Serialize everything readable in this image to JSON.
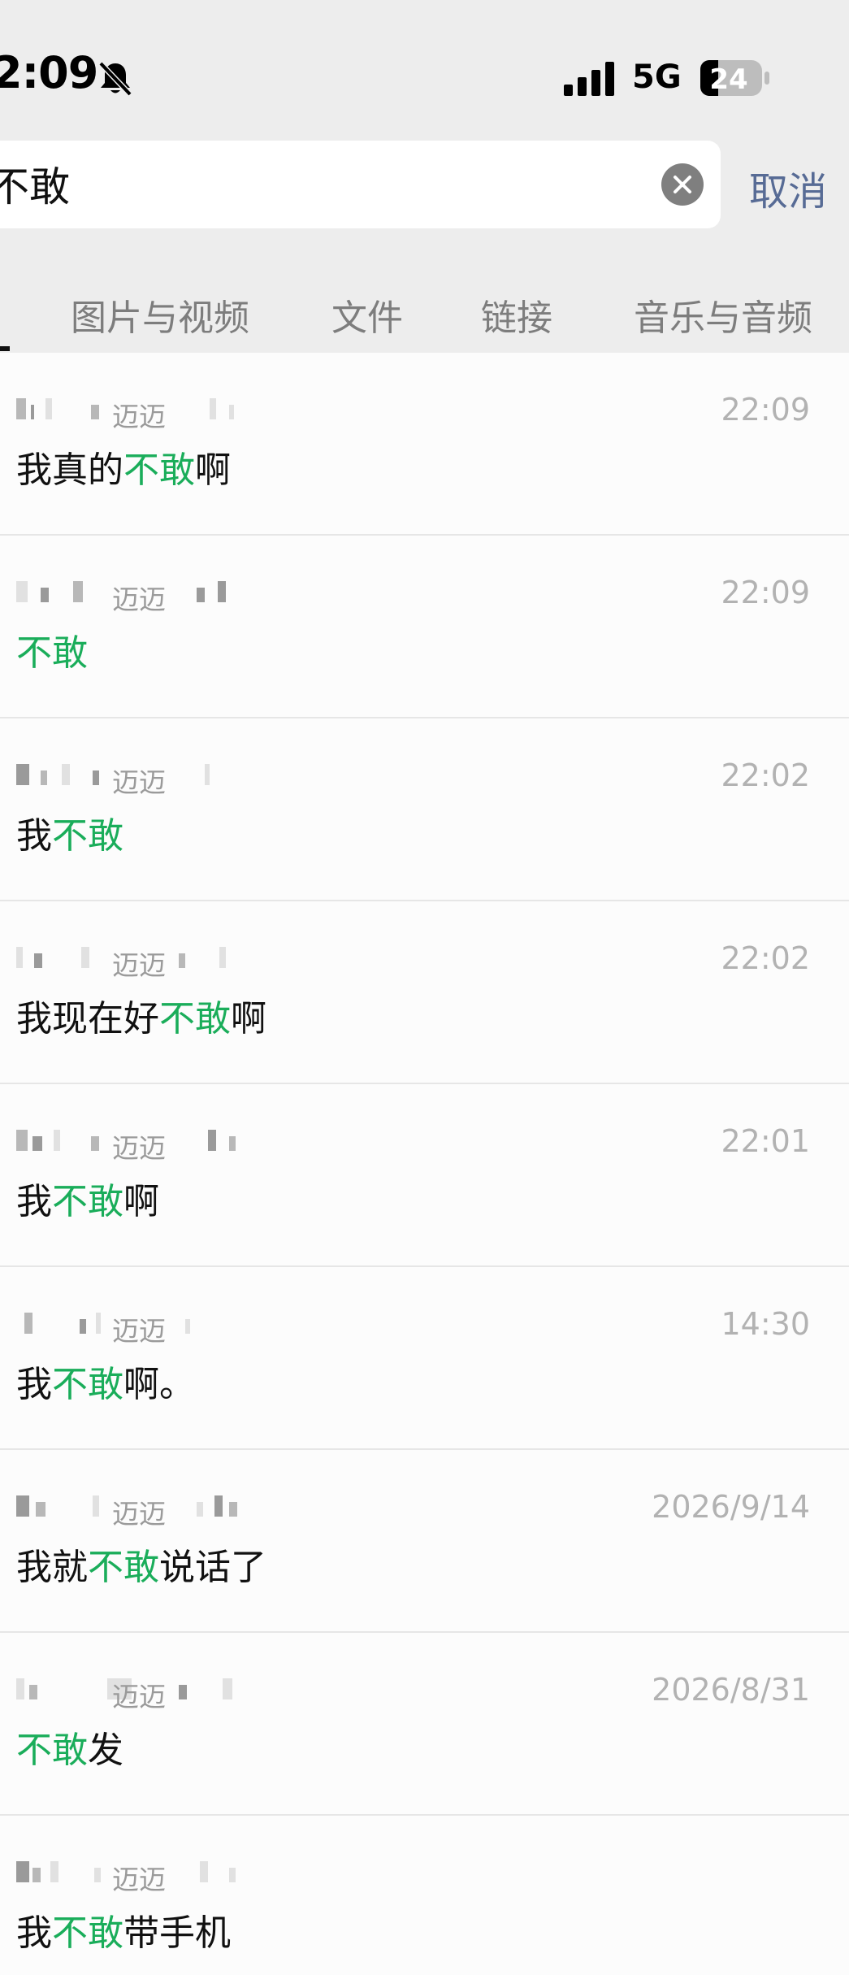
{
  "status_bar": {
    "time": "2:09",
    "network": "5G",
    "battery": "24"
  },
  "search": {
    "value": "不敢",
    "placeholder": "",
    "cancel_label": "取消"
  },
  "tabs": [
    {
      "label": "图片与视频"
    },
    {
      "label": "文件"
    },
    {
      "label": "链接"
    },
    {
      "label": "音乐与音频"
    }
  ],
  "colors": {
    "highlight": "#1aad5a",
    "cancel_link": "#576b95",
    "header_bg": "#ededed"
  },
  "results": [
    {
      "sender": "迈迈",
      "time": "22:09",
      "before": "我真的",
      "match": "不敢",
      "after": "啊"
    },
    {
      "sender": "迈迈",
      "time": "22:09",
      "before": "",
      "match": "不敢",
      "after": ""
    },
    {
      "sender": "迈迈",
      "time": "22:02",
      "before": "我",
      "match": "不敢",
      "after": ""
    },
    {
      "sender": "迈迈",
      "time": "22:02",
      "before": "我现在好",
      "match": "不敢",
      "after": "啊"
    },
    {
      "sender": "迈迈",
      "time": "22:01",
      "before": "我",
      "match": "不敢",
      "after": "啊"
    },
    {
      "sender": "迈迈",
      "time": "14:30",
      "before": "我",
      "match": "不敢",
      "after": "啊。"
    },
    {
      "sender": "迈迈",
      "time": "2026/9/14",
      "before": "我就",
      "match": "不敢",
      "after": "说话了"
    },
    {
      "sender": "迈迈",
      "time": "2026/8/31",
      "before": "",
      "match": "不敢",
      "after": "发"
    },
    {
      "sender": "迈迈",
      "time": "",
      "before": "我",
      "match": "不敢",
      "after": "带手机"
    }
  ]
}
